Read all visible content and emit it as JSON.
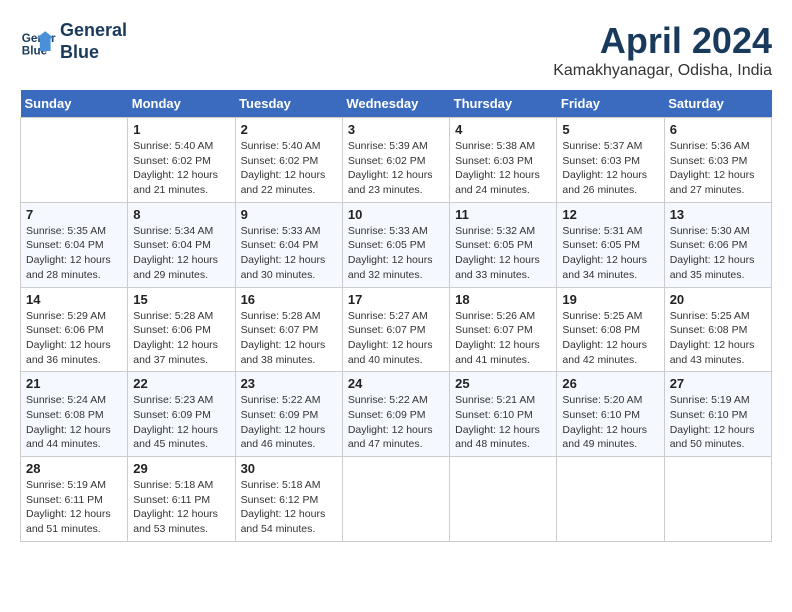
{
  "header": {
    "logo_line1": "General",
    "logo_line2": "Blue",
    "month": "April 2024",
    "location": "Kamakhyanagar, Odisha, India"
  },
  "weekdays": [
    "Sunday",
    "Monday",
    "Tuesday",
    "Wednesday",
    "Thursday",
    "Friday",
    "Saturday"
  ],
  "weeks": [
    [
      {
        "day": "",
        "info": ""
      },
      {
        "day": "1",
        "info": "Sunrise: 5:40 AM\nSunset: 6:02 PM\nDaylight: 12 hours\nand 21 minutes."
      },
      {
        "day": "2",
        "info": "Sunrise: 5:40 AM\nSunset: 6:02 PM\nDaylight: 12 hours\nand 22 minutes."
      },
      {
        "day": "3",
        "info": "Sunrise: 5:39 AM\nSunset: 6:02 PM\nDaylight: 12 hours\nand 23 minutes."
      },
      {
        "day": "4",
        "info": "Sunrise: 5:38 AM\nSunset: 6:03 PM\nDaylight: 12 hours\nand 24 minutes."
      },
      {
        "day": "5",
        "info": "Sunrise: 5:37 AM\nSunset: 6:03 PM\nDaylight: 12 hours\nand 26 minutes."
      },
      {
        "day": "6",
        "info": "Sunrise: 5:36 AM\nSunset: 6:03 PM\nDaylight: 12 hours\nand 27 minutes."
      }
    ],
    [
      {
        "day": "7",
        "info": "Sunrise: 5:35 AM\nSunset: 6:04 PM\nDaylight: 12 hours\nand 28 minutes."
      },
      {
        "day": "8",
        "info": "Sunrise: 5:34 AM\nSunset: 6:04 PM\nDaylight: 12 hours\nand 29 minutes."
      },
      {
        "day": "9",
        "info": "Sunrise: 5:33 AM\nSunset: 6:04 PM\nDaylight: 12 hours\nand 30 minutes."
      },
      {
        "day": "10",
        "info": "Sunrise: 5:33 AM\nSunset: 6:05 PM\nDaylight: 12 hours\nand 32 minutes."
      },
      {
        "day": "11",
        "info": "Sunrise: 5:32 AM\nSunset: 6:05 PM\nDaylight: 12 hours\nand 33 minutes."
      },
      {
        "day": "12",
        "info": "Sunrise: 5:31 AM\nSunset: 6:05 PM\nDaylight: 12 hours\nand 34 minutes."
      },
      {
        "day": "13",
        "info": "Sunrise: 5:30 AM\nSunset: 6:06 PM\nDaylight: 12 hours\nand 35 minutes."
      }
    ],
    [
      {
        "day": "14",
        "info": "Sunrise: 5:29 AM\nSunset: 6:06 PM\nDaylight: 12 hours\nand 36 minutes."
      },
      {
        "day": "15",
        "info": "Sunrise: 5:28 AM\nSunset: 6:06 PM\nDaylight: 12 hours\nand 37 minutes."
      },
      {
        "day": "16",
        "info": "Sunrise: 5:28 AM\nSunset: 6:07 PM\nDaylight: 12 hours\nand 38 minutes."
      },
      {
        "day": "17",
        "info": "Sunrise: 5:27 AM\nSunset: 6:07 PM\nDaylight: 12 hours\nand 40 minutes."
      },
      {
        "day": "18",
        "info": "Sunrise: 5:26 AM\nSunset: 6:07 PM\nDaylight: 12 hours\nand 41 minutes."
      },
      {
        "day": "19",
        "info": "Sunrise: 5:25 AM\nSunset: 6:08 PM\nDaylight: 12 hours\nand 42 minutes."
      },
      {
        "day": "20",
        "info": "Sunrise: 5:25 AM\nSunset: 6:08 PM\nDaylight: 12 hours\nand 43 minutes."
      }
    ],
    [
      {
        "day": "21",
        "info": "Sunrise: 5:24 AM\nSunset: 6:08 PM\nDaylight: 12 hours\nand 44 minutes."
      },
      {
        "day": "22",
        "info": "Sunrise: 5:23 AM\nSunset: 6:09 PM\nDaylight: 12 hours\nand 45 minutes."
      },
      {
        "day": "23",
        "info": "Sunrise: 5:22 AM\nSunset: 6:09 PM\nDaylight: 12 hours\nand 46 minutes."
      },
      {
        "day": "24",
        "info": "Sunrise: 5:22 AM\nSunset: 6:09 PM\nDaylight: 12 hours\nand 47 minutes."
      },
      {
        "day": "25",
        "info": "Sunrise: 5:21 AM\nSunset: 6:10 PM\nDaylight: 12 hours\nand 48 minutes."
      },
      {
        "day": "26",
        "info": "Sunrise: 5:20 AM\nSunset: 6:10 PM\nDaylight: 12 hours\nand 49 minutes."
      },
      {
        "day": "27",
        "info": "Sunrise: 5:19 AM\nSunset: 6:10 PM\nDaylight: 12 hours\nand 50 minutes."
      }
    ],
    [
      {
        "day": "28",
        "info": "Sunrise: 5:19 AM\nSunset: 6:11 PM\nDaylight: 12 hours\nand 51 minutes."
      },
      {
        "day": "29",
        "info": "Sunrise: 5:18 AM\nSunset: 6:11 PM\nDaylight: 12 hours\nand 53 minutes."
      },
      {
        "day": "30",
        "info": "Sunrise: 5:18 AM\nSunset: 6:12 PM\nDaylight: 12 hours\nand 54 minutes."
      },
      {
        "day": "",
        "info": ""
      },
      {
        "day": "",
        "info": ""
      },
      {
        "day": "",
        "info": ""
      },
      {
        "day": "",
        "info": ""
      }
    ]
  ]
}
